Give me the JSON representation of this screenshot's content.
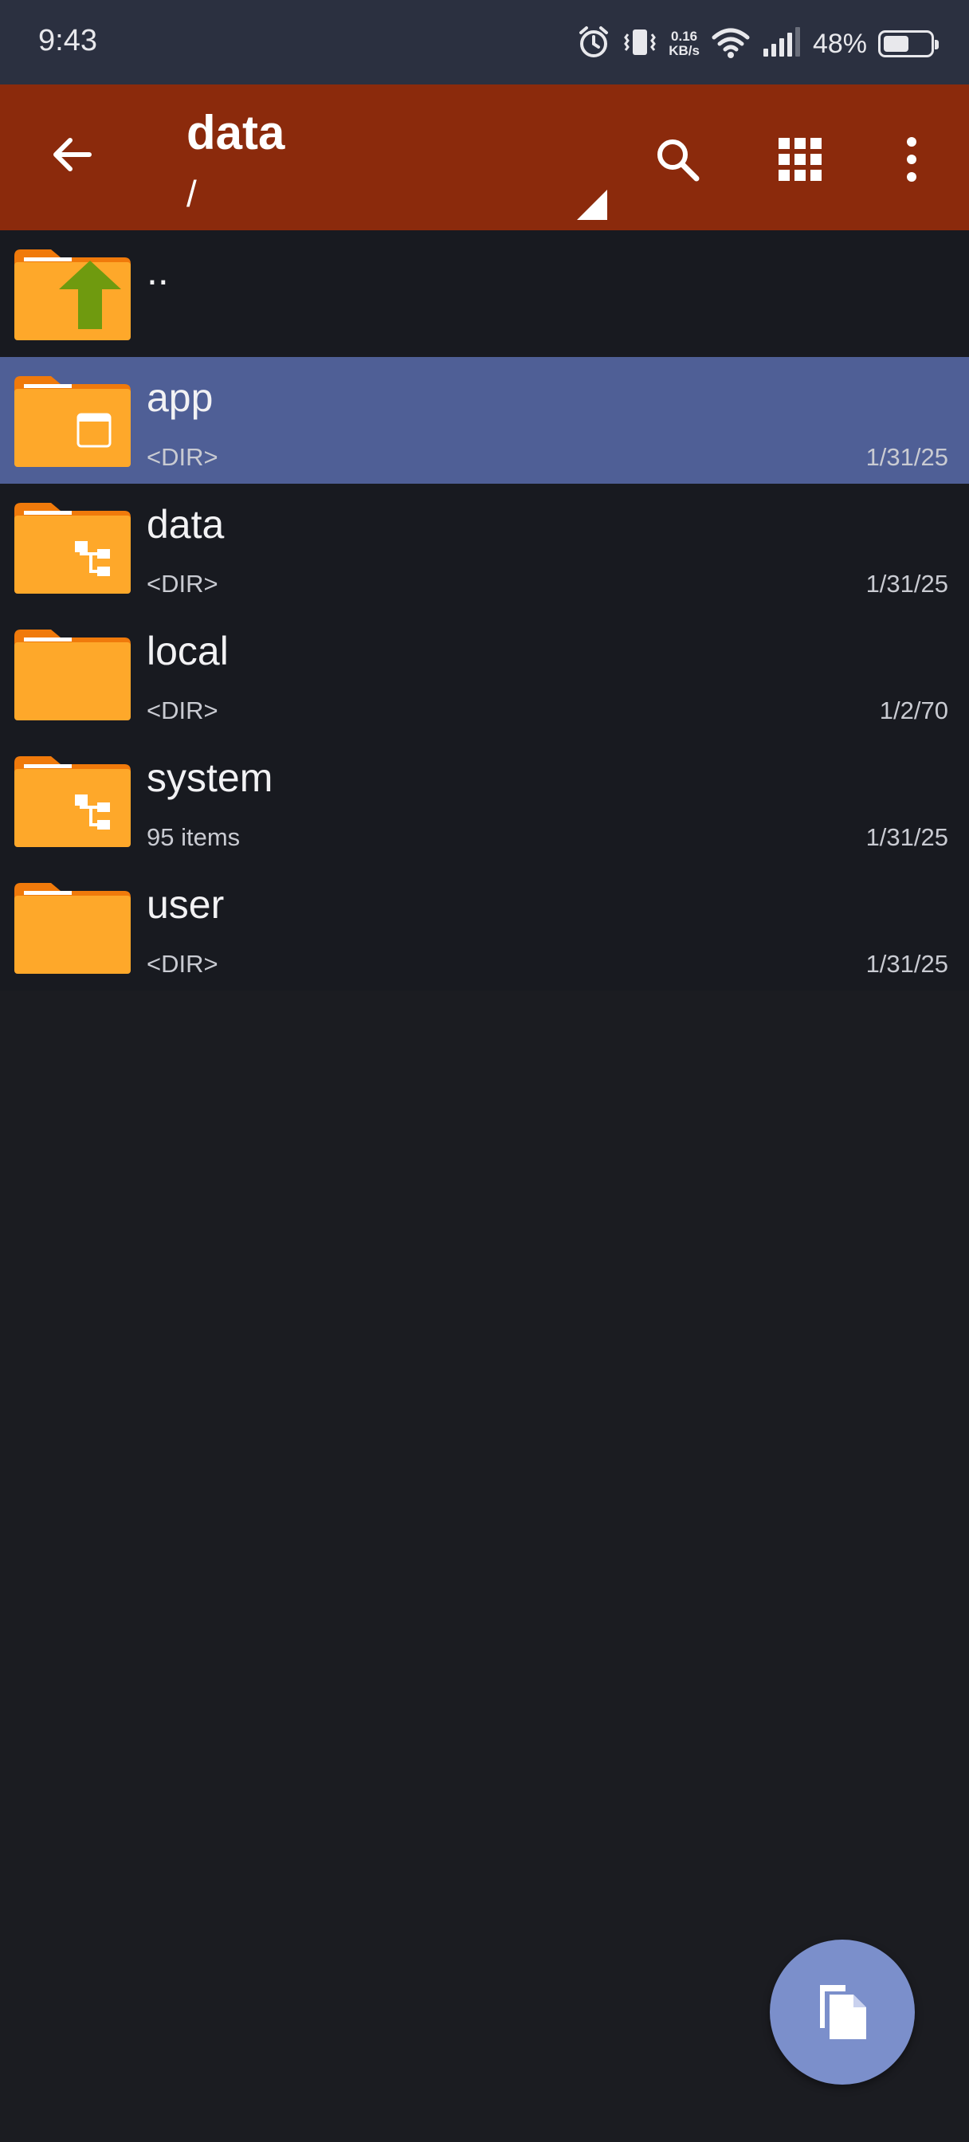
{
  "status_bar": {
    "time": "9:43",
    "net_speed_value": "0.16",
    "net_speed_unit": "KB/s",
    "battery_percent": "48%",
    "battery_level": 0.48,
    "icons": [
      "alarm-icon",
      "vibrate-icon",
      "wifi-icon",
      "signal-icon",
      "battery-icon"
    ]
  },
  "app_bar": {
    "title": "data",
    "path": "/",
    "icons": [
      "back-arrow-icon",
      "search-icon",
      "grid-view-icon",
      "more-vert-icon"
    ]
  },
  "files": [
    {
      "name": "..",
      "meta": "",
      "date": "",
      "icon": "folder-up-icon",
      "selected": false
    },
    {
      "name": "app",
      "meta": "<DIR>",
      "date": "1/31/25",
      "icon": "folder-app-icon",
      "selected": true
    },
    {
      "name": "data",
      "meta": "<DIR>",
      "date": "1/31/25",
      "icon": "folder-tree-icon",
      "selected": false
    },
    {
      "name": "local",
      "meta": "<DIR>",
      "date": "1/2/70",
      "icon": "folder-icon",
      "selected": false
    },
    {
      "name": "system",
      "meta": "95 items",
      "date": "1/31/25",
      "icon": "folder-tree-icon",
      "selected": false
    },
    {
      "name": "user",
      "meta": "<DIR>",
      "date": "1/31/25",
      "icon": "folder-icon",
      "selected": false
    }
  ],
  "fab": {
    "icon": "copy-file-icon"
  },
  "colors": {
    "status_bar": "#2b3040",
    "app_bar": "#8b2a0c",
    "background": "#1b1c21",
    "selected_row": "#4f5f96",
    "folder": "#fea82a",
    "folder_tab": "#f07a0b",
    "up_arrow": "#6f9a0f",
    "fab": "#7b8fcb"
  }
}
